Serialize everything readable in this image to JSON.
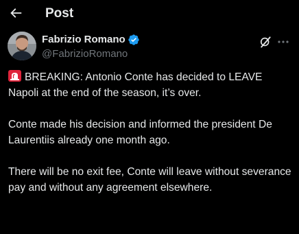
{
  "header": {
    "back_icon": "arrow-left-icon",
    "title": "Post"
  },
  "author": {
    "name": "Fabrizio Romano",
    "handle": "@FabrizioRomano",
    "verified": true,
    "verified_color": "#1d9bf0"
  },
  "actions": {
    "grok_icon": "grok-icon",
    "more_icon": "more-horizontal-icon"
  },
  "tweet": {
    "emoji": "siren-emoji",
    "paragraphs": [
      "BREAKING: Antonio Conte has decided to LEAVE Napoli at the end of the season, it’s over.",
      "Conte made his decision and informed the president De Laurentiis already one month ago.",
      "There will be no exit fee, Conte will leave without severance pay and without any agreement elsewhere."
    ]
  },
  "colors": {
    "background": "#000000",
    "text_primary": "#e7e9ea",
    "text_secondary": "#71767b",
    "accent": "#1d9bf0",
    "siren_red": "#e0243b"
  }
}
